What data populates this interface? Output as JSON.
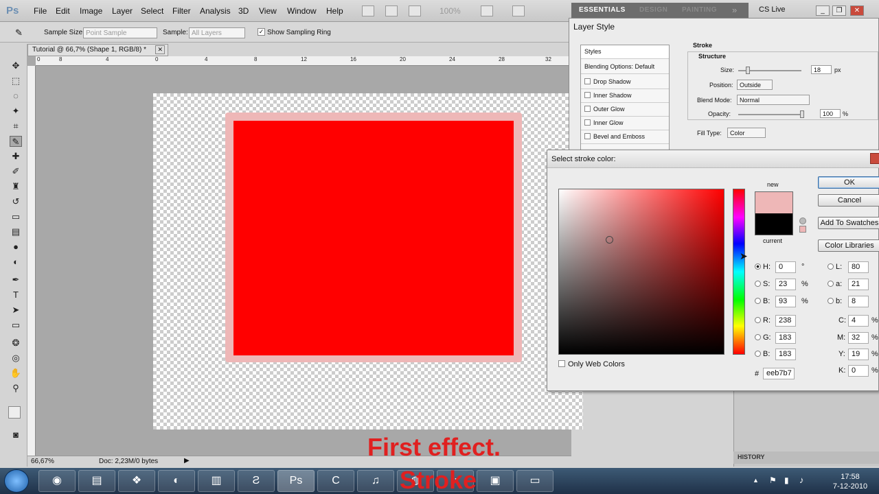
{
  "app": {
    "logo": "Ps"
  },
  "menu": [
    "File",
    "Edit",
    "Image",
    "Layer",
    "Select",
    "Filter",
    "Analysis",
    "3D",
    "View",
    "Window",
    "Help"
  ],
  "toolbar": {
    "zoom": "100%"
  },
  "workspaces": [
    "ESSENTIALS",
    "DESIGN",
    "PAINTING"
  ],
  "cslive": "CS Live",
  "options": {
    "sample_size_label": "Sample Size:",
    "sample_size_value": "Point Sample",
    "sample_label": "Sample:",
    "sample_value": "All Layers",
    "sampling_ring": "Show Sampling Ring"
  },
  "document": {
    "tab": "Tutorial @ 66,7% (Shape 1, RGB/8) *",
    "ruler_ticks": [
      "0",
      "8",
      "4",
      "0",
      "4",
      "8",
      "12",
      "16",
      "20",
      "24",
      "28",
      "32"
    ],
    "zoom_status": "66,67%",
    "doc_size": "Doc: 2,23M/0 bytes"
  },
  "layer_style": {
    "title": "Layer Style",
    "list": [
      "Styles",
      "Blending Options: Default",
      "Drop Shadow",
      "Inner Shadow",
      "Outer Glow",
      "Inner Glow",
      "Bevel and Emboss"
    ],
    "section": "Stroke",
    "structure": "Structure",
    "size_label": "Size:",
    "size_value": "18",
    "size_unit": "px",
    "position_label": "Position:",
    "position_value": "Outside",
    "blend_label": "Blend Mode:",
    "blend_value": "Normal",
    "opacity_label": "Opacity:",
    "opacity_value": "100",
    "opacity_unit": "%",
    "fill_label": "Fill Type:",
    "fill_value": "Color"
  },
  "color_picker": {
    "title": "Select stroke color:",
    "new_label": "new",
    "current_label": "current",
    "new_color": "#eeb7b7",
    "current_color": "#000000",
    "ok": "OK",
    "cancel": "Cancel",
    "add_swatches": "Add To Swatches",
    "color_libraries": "Color Libraries",
    "hsb": [
      {
        "label": "H:",
        "value": "0",
        "unit": "°"
      },
      {
        "label": "S:",
        "value": "23",
        "unit": "%"
      },
      {
        "label": "B:",
        "value": "93",
        "unit": "%"
      }
    ],
    "rgb": [
      {
        "label": "R:",
        "value": "238"
      },
      {
        "label": "G:",
        "value": "183"
      },
      {
        "label": "B:",
        "value": "183"
      }
    ],
    "lab": [
      {
        "label": "L:",
        "value": "80"
      },
      {
        "label": "a:",
        "value": "21"
      },
      {
        "label": "b:",
        "value": "8"
      }
    ],
    "cmyk": [
      {
        "label": "C:",
        "value": "4",
        "unit": "%"
      },
      {
        "label": "M:",
        "value": "32",
        "unit": "%"
      },
      {
        "label": "Y:",
        "value": "19",
        "unit": "%"
      },
      {
        "label": "K:",
        "value": "0",
        "unit": "%"
      }
    ],
    "hex_label": "#",
    "hex": "eeb7b7",
    "only_web": "Only Web Colors"
  },
  "history_panel": "HISTORY",
  "caption": {
    "line1": "First effect.",
    "line2": "Stroke"
  },
  "taskbar": {
    "time": "17:58",
    "date": "7-12-2010"
  }
}
